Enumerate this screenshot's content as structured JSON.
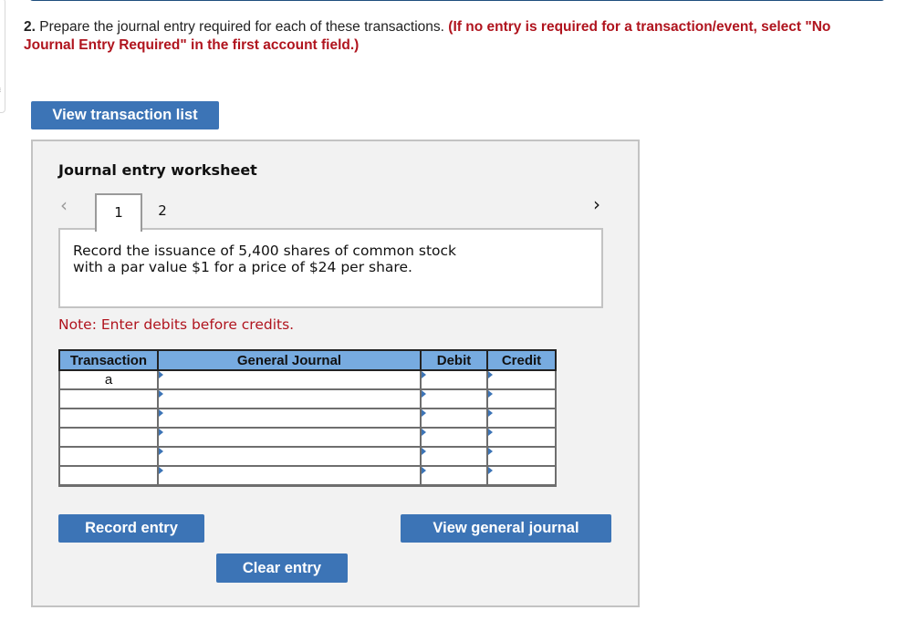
{
  "question": {
    "number": "2.",
    "text": "Prepare the journal entry required for each of these transactions.",
    "instruction": "(If no entry is required for a transaction/event, select \"No Journal Entry Required\" in the first account field.)"
  },
  "buttons": {
    "view_transaction_list": "View transaction list",
    "record_entry": "Record entry",
    "view_general_journal": "View general journal",
    "clear_entry": "Clear entry"
  },
  "worksheet": {
    "title": "Journal entry worksheet",
    "nav_prev_icon": "‹",
    "nav_next_icon": "›",
    "tabs": [
      {
        "label": "1",
        "active": true
      },
      {
        "label": "2",
        "active": false
      }
    ],
    "description_line1": "Record the issuance of 5,400 shares of common stock",
    "description_line2": "with a par value $1 for a price of $24 per share.",
    "note": "Note: Enter debits before credits."
  },
  "journal_table": {
    "columns": [
      "Transaction",
      "General Journal",
      "Debit",
      "Credit"
    ],
    "rows": [
      {
        "transaction": "a",
        "account": "",
        "debit": "",
        "credit": ""
      },
      {
        "transaction": "",
        "account": "",
        "debit": "",
        "credit": ""
      },
      {
        "transaction": "",
        "account": "",
        "debit": "",
        "credit": ""
      },
      {
        "transaction": "",
        "account": "",
        "debit": "",
        "credit": ""
      },
      {
        "transaction": "",
        "account": "",
        "debit": "",
        "credit": ""
      },
      {
        "transaction": "",
        "account": "",
        "debit": "",
        "credit": ""
      }
    ]
  },
  "colors": {
    "button_blue": "#3c74b6",
    "header_blue": "#77abe0",
    "instruction_red": "#b0141e",
    "top_bar_navy": "#1f4e7e"
  }
}
